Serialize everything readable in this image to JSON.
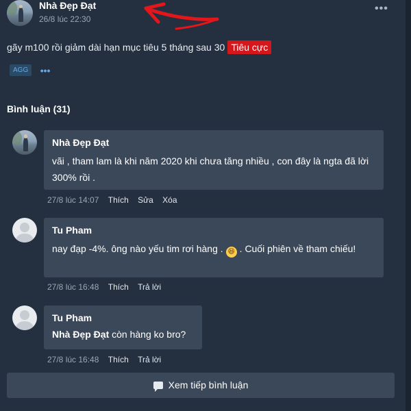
{
  "post": {
    "author": "Nhà Đẹp Đạt",
    "time": "26/8 lúc 22:30",
    "text": "gãy m100 rồi giảm dài hạn mục tiêu 5 tháng sau 30",
    "sentiment": "Tiêu cực",
    "tags": [
      "AGG"
    ],
    "more_menu": "•••",
    "tags_more": "•••"
  },
  "comments_title": "Bình luận (31)",
  "comments": [
    {
      "author": "Nhà Đẹp Đạt",
      "text": "vãi , tham lam là khi năm 2020 khi chưa tăng nhiều , con đây là ngta đã lời 300% rồi .",
      "time": "27/8 lúc 14:07",
      "actions": [
        "Thích",
        "Sửa",
        "Xóa"
      ]
    },
    {
      "author": "Tu Pham",
      "text_before": "nay đạp -4%. ông nào yếu tim rơi hàng .",
      "emoji": "😆",
      "text_after": ". Cuối phiên về tham chiếu!",
      "time": "27/8 lúc 16:48",
      "actions": [
        "Thích",
        "Trả lời"
      ]
    },
    {
      "author": "Tu Pham",
      "mention": "Nhà Đẹp Đạt",
      "text": "còn hàng ko bro?",
      "time": "27/8 lúc 16:48",
      "actions": [
        "Thích",
        "Trả lời"
      ]
    }
  ],
  "load_more_label": "Xem tiếp bình luận",
  "colors": {
    "background": "#243040",
    "bubble": "#3b4859",
    "negative_badge": "#d3171b",
    "tag_text": "#69a8e4",
    "annotation_arrow": "#e3161c"
  },
  "icons": {
    "more": "more-horizontal-icon",
    "load_more": "chat-bubble-icon"
  }
}
